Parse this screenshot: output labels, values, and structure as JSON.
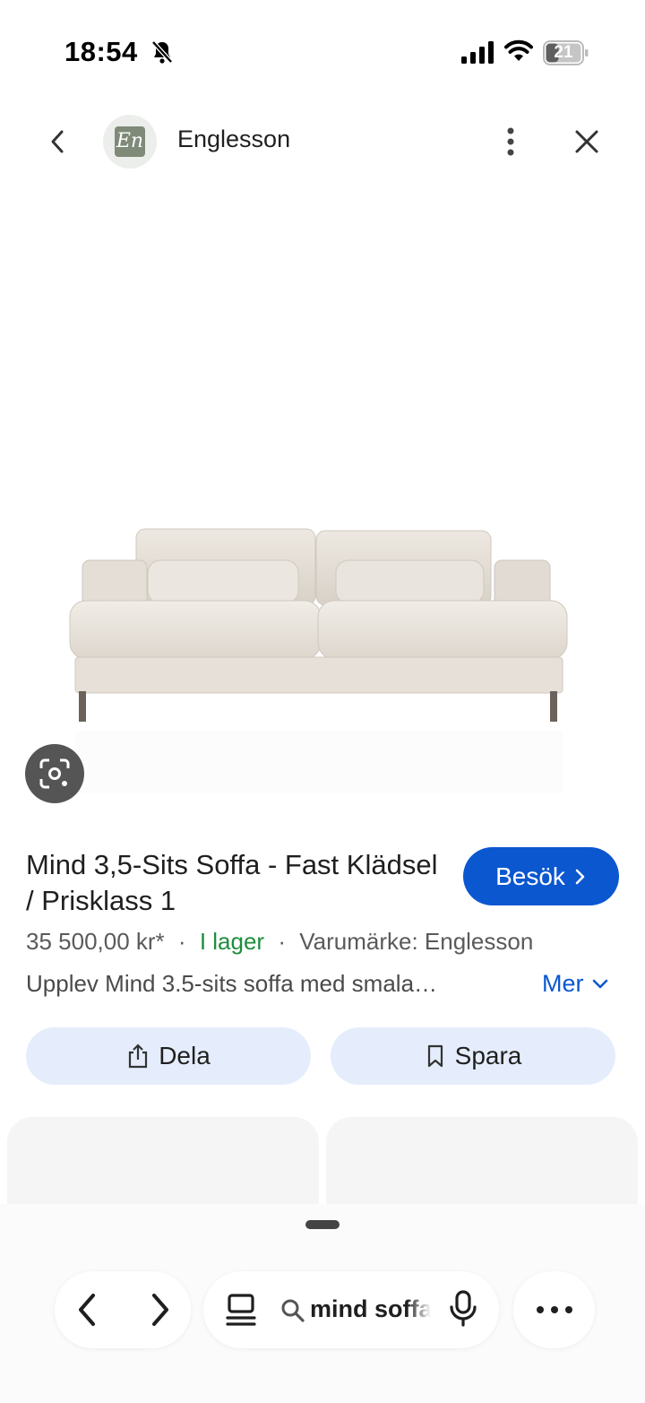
{
  "status_bar": {
    "time": "18:54",
    "battery": "21"
  },
  "header": {
    "site_name": "Englesson",
    "logo_text": "En"
  },
  "product": {
    "title": "Mind 3,5-Sits Soffa - Fast Klädsel / Prisklass 1",
    "visit_label": "Besök",
    "price": "35 500,00 kr*",
    "stock": "I lager",
    "brand": "Varumärke: Englesson",
    "separator": "·",
    "description": "Upplev Mind 3.5-sits soffa med smala…",
    "more_label": "Mer"
  },
  "actions": {
    "share_label": "Dela",
    "save_label": "Spara"
  },
  "bottom_bar": {
    "search_query": "mind soffa"
  },
  "colors": {
    "accent": "#0b57d0",
    "stock_green": "#1e8e3e",
    "pill_bg": "#e5edfc"
  },
  "icons": [
    "bell-slash-icon",
    "signal-icon",
    "wifi-icon",
    "battery-icon",
    "back-icon",
    "more-vert-icon",
    "close-icon",
    "lens-icon",
    "chevron-right-icon",
    "chevron-down-icon",
    "share-icon",
    "bookmark-icon",
    "tabs-icon",
    "search-icon",
    "mic-icon",
    "more-horiz-icon"
  ]
}
